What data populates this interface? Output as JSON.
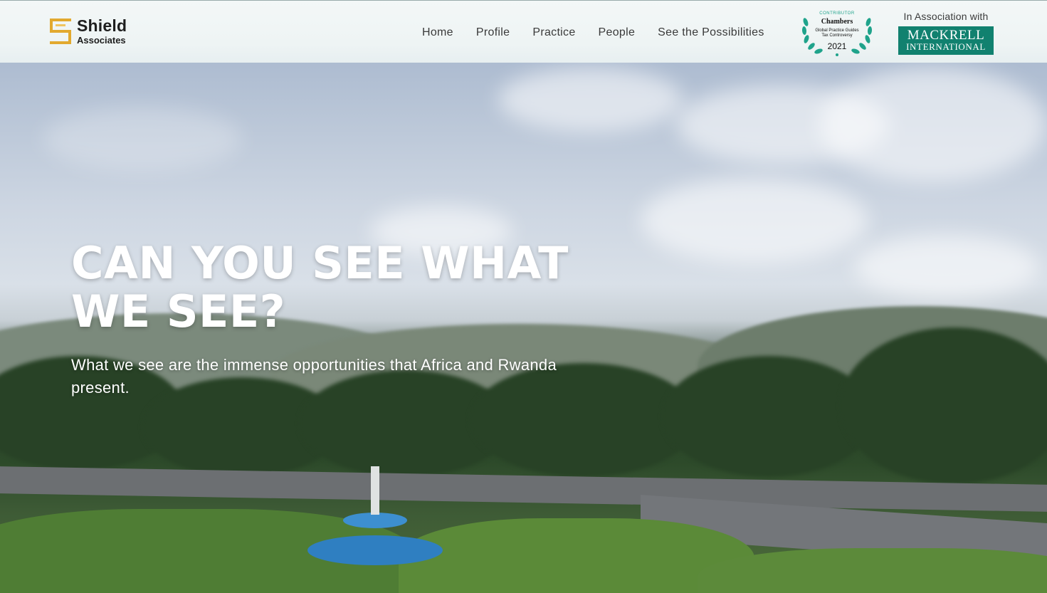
{
  "brand": {
    "name_line1": "Shield",
    "name_line2": "Associates",
    "accent_color": "#e2a92f"
  },
  "nav": {
    "items": [
      {
        "label": "Home"
      },
      {
        "label": "Profile"
      },
      {
        "label": "Practice"
      },
      {
        "label": "People"
      },
      {
        "label": "See the Possibilities"
      }
    ]
  },
  "badge": {
    "contributor": "CONTRIBUTOR",
    "brand": "Chambers",
    "line1": "Global Practice Guides",
    "line2": "Tax Controversy",
    "year": "2021",
    "color": "#1fa38b"
  },
  "association": {
    "label": "In Association with",
    "partner_line1": "MACKRELL",
    "partner_line2": "INTERNATIONAL",
    "partner_color": "#11816f"
  },
  "hero": {
    "headline": "CAN YOU SEE WHAT WE SEE?",
    "subheadline": "What we see are the immense opportunities that Africa and Rwanda present."
  }
}
